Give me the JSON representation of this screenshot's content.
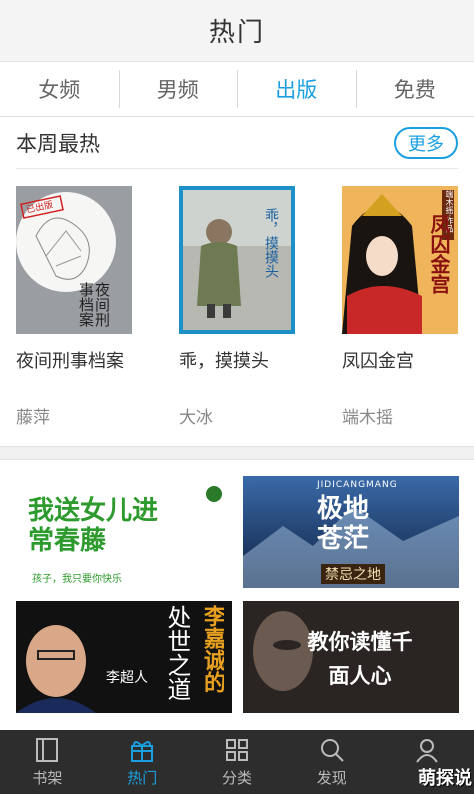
{
  "header": {
    "title": "热门"
  },
  "tabs": [
    {
      "label": "女频"
    },
    {
      "label": "男频"
    },
    {
      "label": "出版"
    },
    {
      "label": "免费"
    }
  ],
  "active_tab": "出版",
  "section": {
    "title": "本周最热",
    "more_label": "更多"
  },
  "books": [
    {
      "title": "夜间刑事档案",
      "author": "藤萍",
      "cover_text": "夜间刑事档案",
      "cover_badge": "已出版"
    },
    {
      "title": "乖，摸摸头",
      "author": "大冰",
      "cover_text": "乖，摸摸头"
    },
    {
      "title": "凤囚金宫",
      "author": "端木摇",
      "cover_text": "凤囚金宫",
      "cover_badge": "端木摇·作品"
    }
  ],
  "banners": [
    {
      "headline": "我送女儿进常春藤",
      "tagline": "孩子，我只要你快乐"
    },
    {
      "headline": "极地苍茫",
      "subline": "禁忌之地",
      "top_text": "JIDICANGMANG"
    },
    {
      "headline": "处世之道",
      "accent": "李嘉诚的",
      "author": "李超人"
    },
    {
      "headline": "教你读懂千面人心"
    }
  ],
  "bottom_nav": [
    {
      "label": "书架",
      "icon": "bookshelf-icon"
    },
    {
      "label": "热门",
      "icon": "gift-icon"
    },
    {
      "label": "分类",
      "icon": "grid-icon"
    },
    {
      "label": "发现",
      "icon": "search-icon"
    },
    {
      "label": "我",
      "icon": "user-icon"
    }
  ],
  "watermark": "萌探说",
  "colors": {
    "accent": "#1aa0e0",
    "nav_bg": "#2d2d2d"
  }
}
